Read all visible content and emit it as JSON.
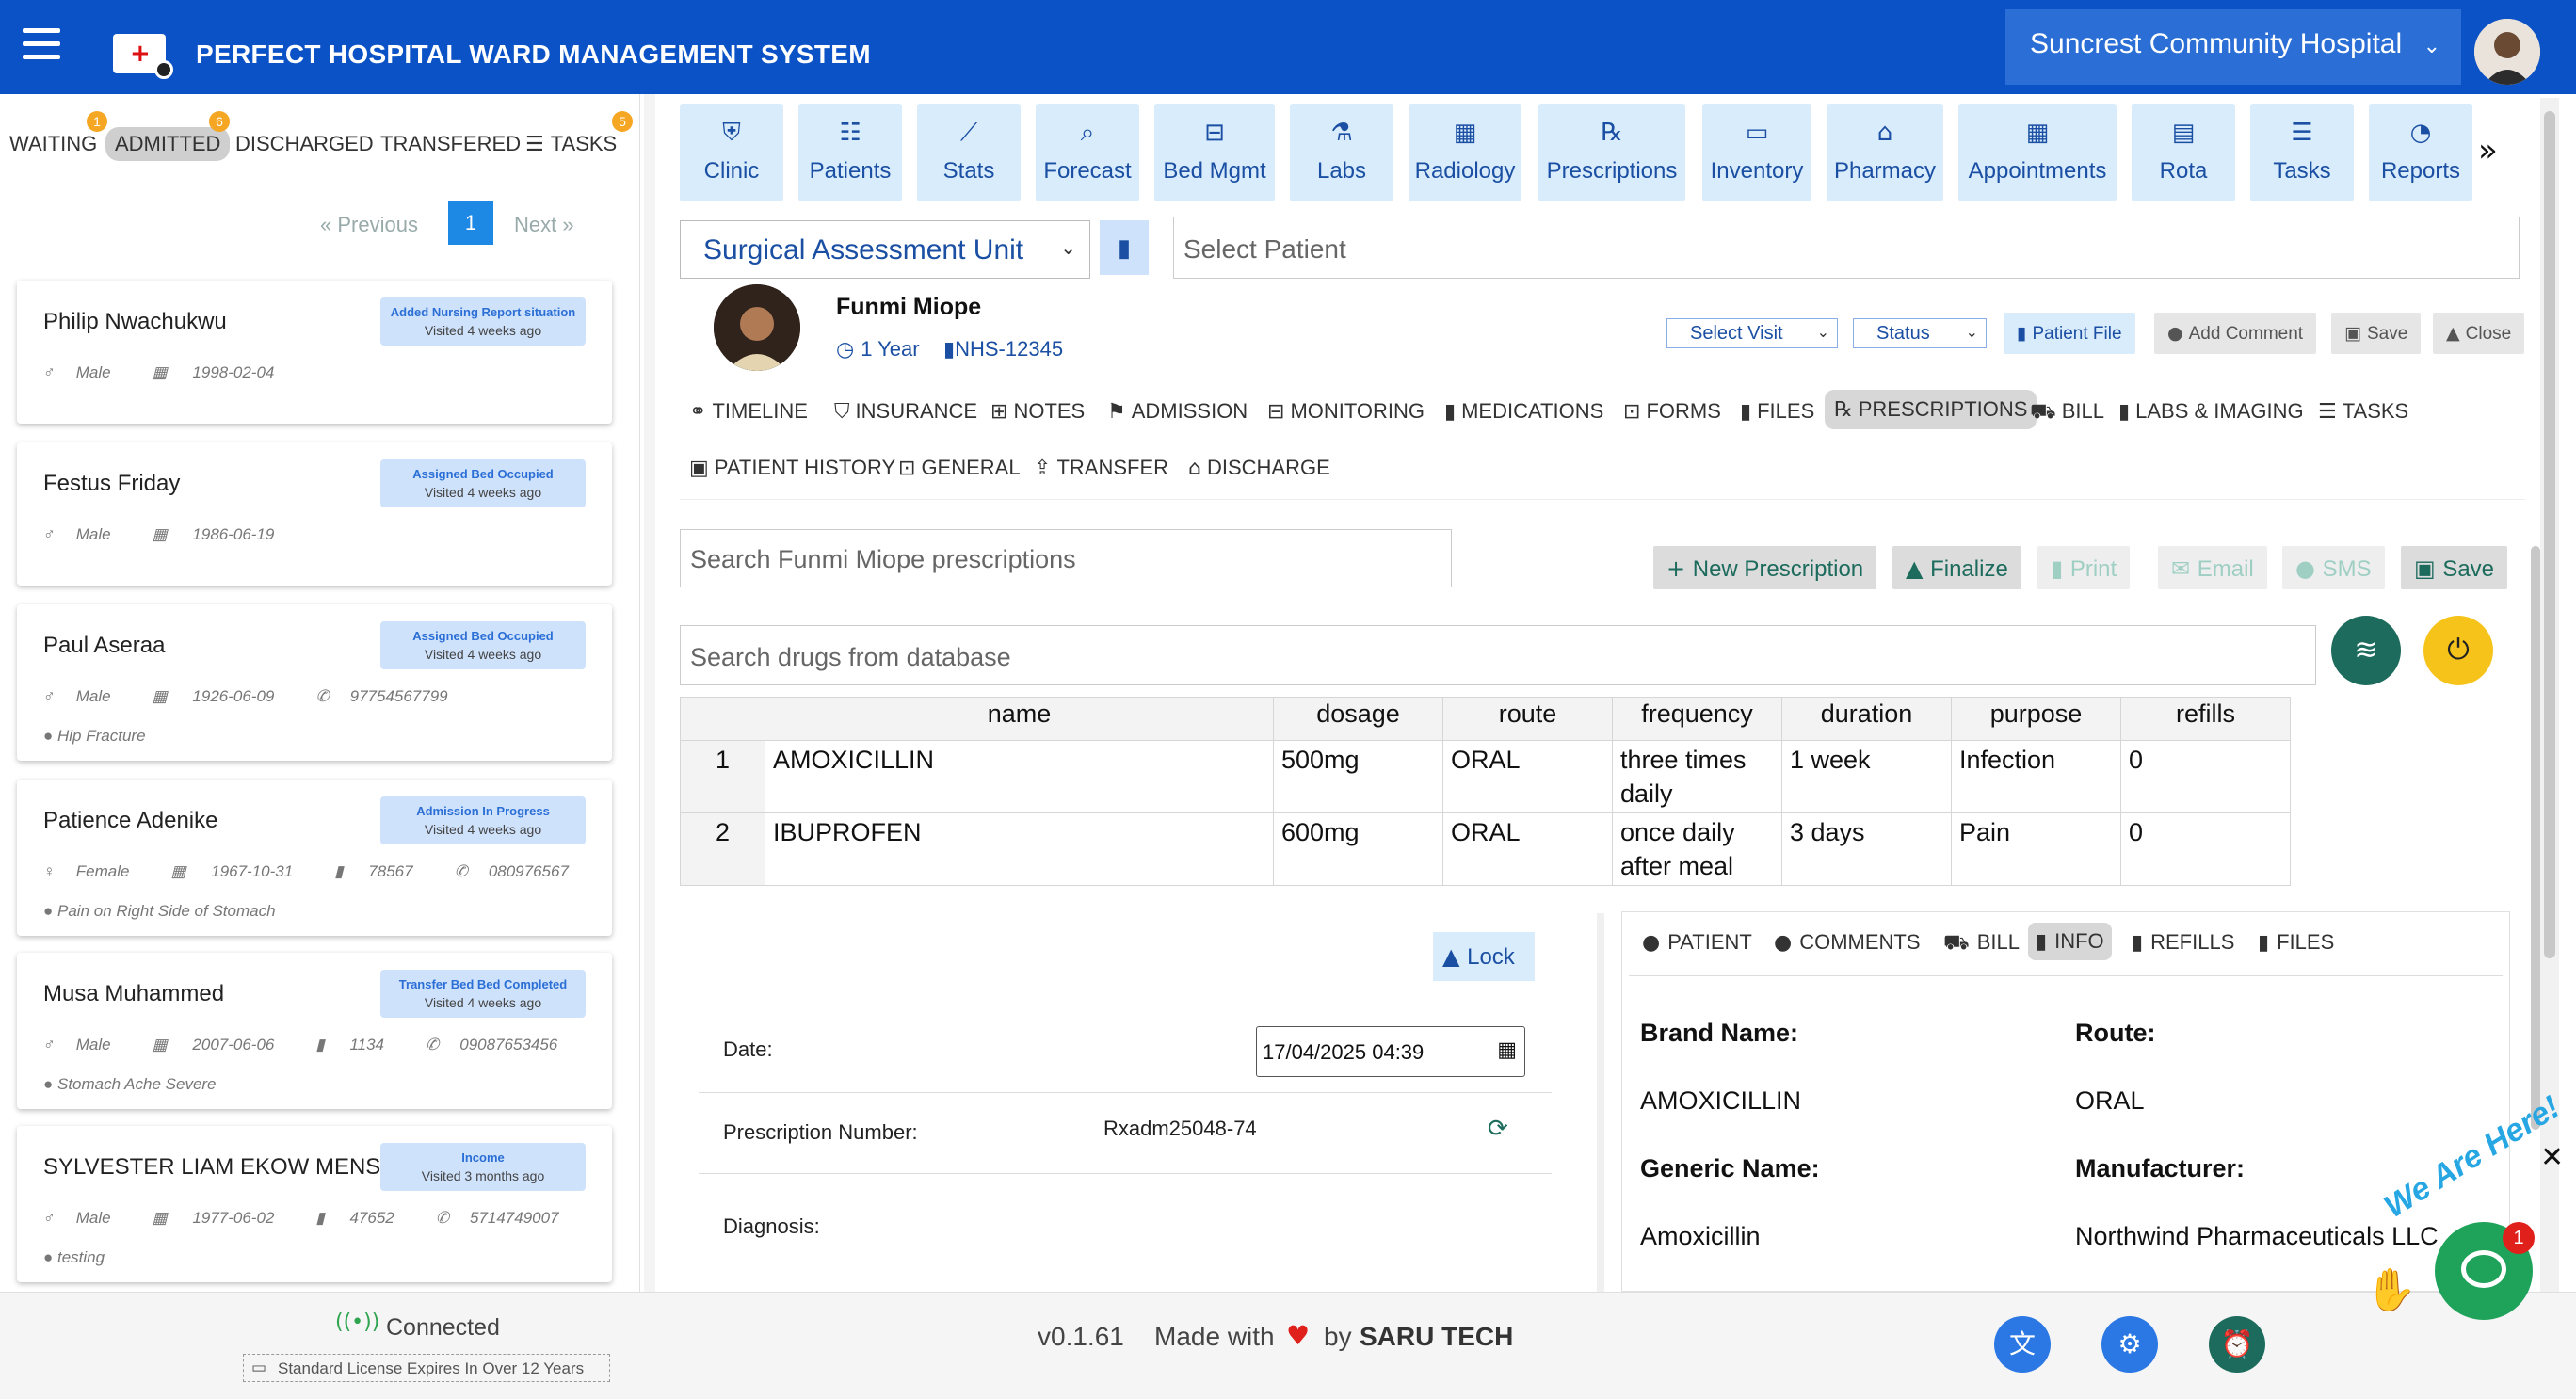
{
  "header": {
    "title": "PERFECT HOSPITAL WARD MANAGEMENT SYSTEM",
    "hospital": "Suncrest Community Hospital"
  },
  "left_panel": {
    "tabs": [
      {
        "label": "WAITING",
        "badge": "1"
      },
      {
        "label": "ADMITTED",
        "badge": "6"
      },
      {
        "label": "DISCHARGED"
      },
      {
        "label": "TRANSFERED"
      },
      {
        "label": "TASKS",
        "badge": "5"
      }
    ],
    "pager": {
      "previous": "Previous",
      "next": "Next",
      "current": "1"
    },
    "patients": [
      {
        "name": "Philip Nwachukwu",
        "status": "Added Nursing Report situation",
        "visited": "Visited 4 weeks ago",
        "gender": "Male",
        "dob": "1998-02-04"
      },
      {
        "name": "Festus Friday",
        "status": "Assigned Bed Occupied",
        "visited": "Visited 4 weeks ago",
        "gender": "Male",
        "dob": "1986-06-19"
      },
      {
        "name": "Paul Aseraa",
        "status": "Assigned Bed Occupied",
        "visited": "Visited 4 weeks ago",
        "gender": "Male",
        "dob": "1926-06-09",
        "phone": "97754567799",
        "diagnosis": "Hip Fracture"
      },
      {
        "name": "Patience Adenike",
        "status": "Admission In Progress",
        "visited": "Visited 4 weeks ago",
        "gender": "Female",
        "dob": "1967-10-31",
        "id": "78567",
        "phone": "080976567",
        "diagnosis": "Pain on Right Side of Stomach"
      },
      {
        "name": "Musa Muhammed",
        "status": "Transfer Bed Bed Completed",
        "visited": "Visited 4 weeks ago",
        "gender": "Male",
        "dob": "2007-06-06",
        "id": "1134",
        "phone": "09087653456",
        "diagnosis": "Stomach Ache Severe"
      },
      {
        "name": "SYLVESTER LIAM EKOW MENSAH",
        "status": "Income",
        "visited": "Visited 3 months ago",
        "gender": "Male",
        "dob": "1977-06-02",
        "id": "47652",
        "phone": "5714749007",
        "diagnosis": "testing"
      }
    ]
  },
  "modules": [
    {
      "label": "Clinic",
      "icon": "clinic-icon",
      "glyph": "⛨"
    },
    {
      "label": "Patients",
      "icon": "id-card-icon",
      "glyph": "☷"
    },
    {
      "label": "Stats",
      "icon": "chart-line-icon",
      "glyph": "⟋"
    },
    {
      "label": "Forecast",
      "icon": "search-chart-icon",
      "glyph": "⌕"
    },
    {
      "label": "Bed Mgmt",
      "icon": "bed-icon",
      "glyph": "⊟"
    },
    {
      "label": "Labs",
      "icon": "flask-icon",
      "glyph": "⚗"
    },
    {
      "label": "Radiology",
      "icon": "xray-icon",
      "glyph": "▦"
    },
    {
      "label": "Prescriptions",
      "icon": "rx-icon",
      "glyph": "℞"
    },
    {
      "label": "Inventory",
      "icon": "box-icon",
      "glyph": "▭"
    },
    {
      "label": "Pharmacy",
      "icon": "store-icon",
      "glyph": "⌂"
    },
    {
      "label": "Appointments",
      "icon": "calendar-icon",
      "glyph": "▦"
    },
    {
      "label": "Rota",
      "icon": "calendar-day-icon",
      "glyph": "▤"
    },
    {
      "label": "Tasks",
      "icon": "list-check-icon",
      "glyph": "☰"
    },
    {
      "label": "Reports",
      "icon": "pie-chart-icon",
      "glyph": "◔"
    }
  ],
  "unit": {
    "selected": "Surgical Assessment Unit"
  },
  "patient_select": {
    "placeholder": "Select  Patient"
  },
  "patient": {
    "name": "Funmi Miope",
    "age": "1 Year",
    "nhs": "NHS-12345",
    "select_visit": "Select Visit",
    "status": "Status",
    "buttons": {
      "file": "Patient File",
      "comment": "Add Comment",
      "save": "Save",
      "close": "Close"
    }
  },
  "patient_tabs": [
    {
      "label": "TIMELINE",
      "glyph": "⚭"
    },
    {
      "label": "INSURANCE",
      "glyph": "⛉"
    },
    {
      "label": "NOTES",
      "glyph": "⊞"
    },
    {
      "label": "ADMISSION",
      "glyph": "⚑"
    },
    {
      "label": "MONITORING",
      "glyph": "⊟"
    },
    {
      "label": "MEDICATIONS",
      "glyph": "▮"
    },
    {
      "label": "FORMS",
      "glyph": "⊡"
    },
    {
      "label": "FILES",
      "glyph": "▮"
    },
    {
      "label": "PRESCRIPTIONS",
      "glyph": "℞"
    },
    {
      "label": "BILL",
      "glyph": "⛟"
    },
    {
      "label": "LABS & IMAGING",
      "glyph": "▮"
    },
    {
      "label": "TASKS",
      "glyph": "☰"
    },
    {
      "label": "PATIENT HISTORY",
      "glyph": "▣"
    },
    {
      "label": "GENERAL",
      "glyph": "⊡"
    },
    {
      "label": "TRANSFER",
      "glyph": "⇪"
    },
    {
      "label": "DISCHARGE",
      "glyph": "⌂"
    }
  ],
  "prescriptions": {
    "search_placeholder": "Search Funmi Miope prescriptions",
    "drug_search_placeholder": "Search drugs from database",
    "buttons": {
      "new": "New Prescription",
      "finalize": "Finalize",
      "print": "Print",
      "email": "Email",
      "sms": "SMS",
      "save": "Save"
    },
    "columns": [
      "name",
      "dosage",
      "route",
      "frequency",
      "duration",
      "purpose",
      "refills"
    ],
    "rows": [
      {
        "index": "1",
        "name": "AMOXICILLIN",
        "dosage": "500mg",
        "route": "ORAL",
        "frequency": "three times daily",
        "duration": "1 week",
        "purpose": "Infection",
        "refills": "0"
      },
      {
        "index": "2",
        "name": "IBUPROFEN",
        "dosage": "600mg",
        "route": "ORAL",
        "frequency": "once daily after meal",
        "duration": "3 days",
        "purpose": "Pain",
        "refills": "0"
      }
    ]
  },
  "form": {
    "lock": "Lock",
    "date_label": "Date:",
    "date_value": "17/04/2025 04:39",
    "rxnum_label": "Prescription Number:",
    "rxnum_value": "Rxadm25048-74",
    "diagnosis_label": "Diagnosis:"
  },
  "detail": {
    "tabs": [
      "PATIENT",
      "COMMENTS",
      "BILL",
      "INFO",
      "REFILLS",
      "FILES"
    ],
    "brand_label": "Brand Name:",
    "brand_value": "AMOXICILLIN",
    "route_label": "Route:",
    "route_value": "ORAL",
    "generic_label": "Generic Name:",
    "generic_value": "Amoxicillin",
    "manufacturer_label": "Manufacturer:",
    "manufacturer_value": "Northwind Pharmaceuticals LLC"
  },
  "footer": {
    "connection": "Connected",
    "license": "Standard License Expires In Over 12 Years",
    "version": "v0.1.61",
    "made_with": "Made with",
    "by": "by",
    "company": "SARU TECH"
  },
  "chat": {
    "tagline": "We Are Here!",
    "badge": "1"
  },
  "colors": {
    "primary": "#0b52c7",
    "accent_light": "#d9ecfb",
    "teal": "#1c6b5c",
    "yellow": "#f6c31b",
    "green": "#1fa35a"
  }
}
